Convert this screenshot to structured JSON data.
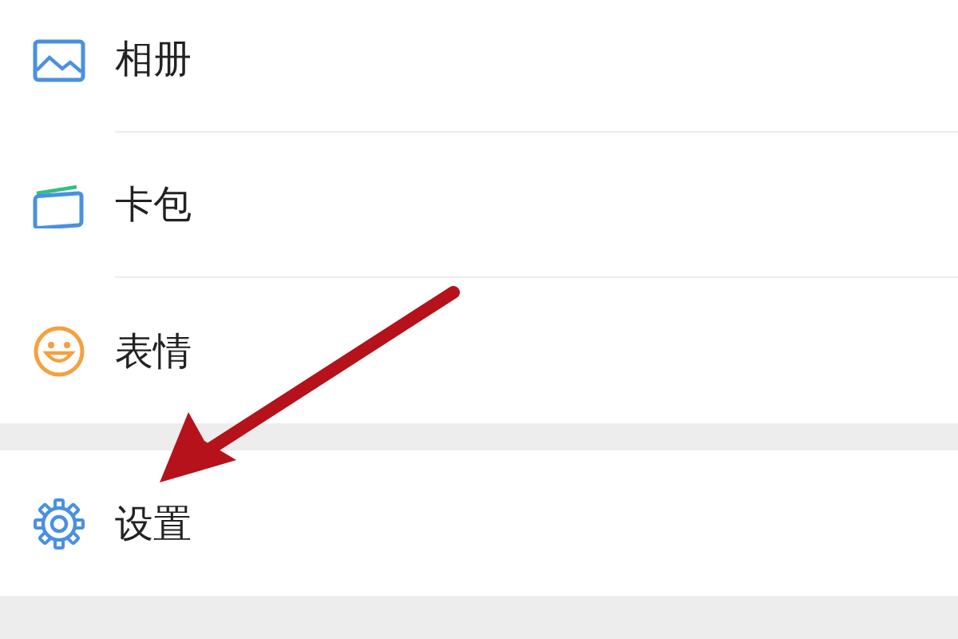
{
  "menu_groups": [
    {
      "items": [
        {
          "kind": "album",
          "label": "相册"
        },
        {
          "kind": "card",
          "label": "卡包"
        },
        {
          "kind": "emoji",
          "label": "表情"
        }
      ]
    },
    {
      "items": [
        {
          "kind": "settings",
          "label": "设置"
        }
      ]
    }
  ]
}
